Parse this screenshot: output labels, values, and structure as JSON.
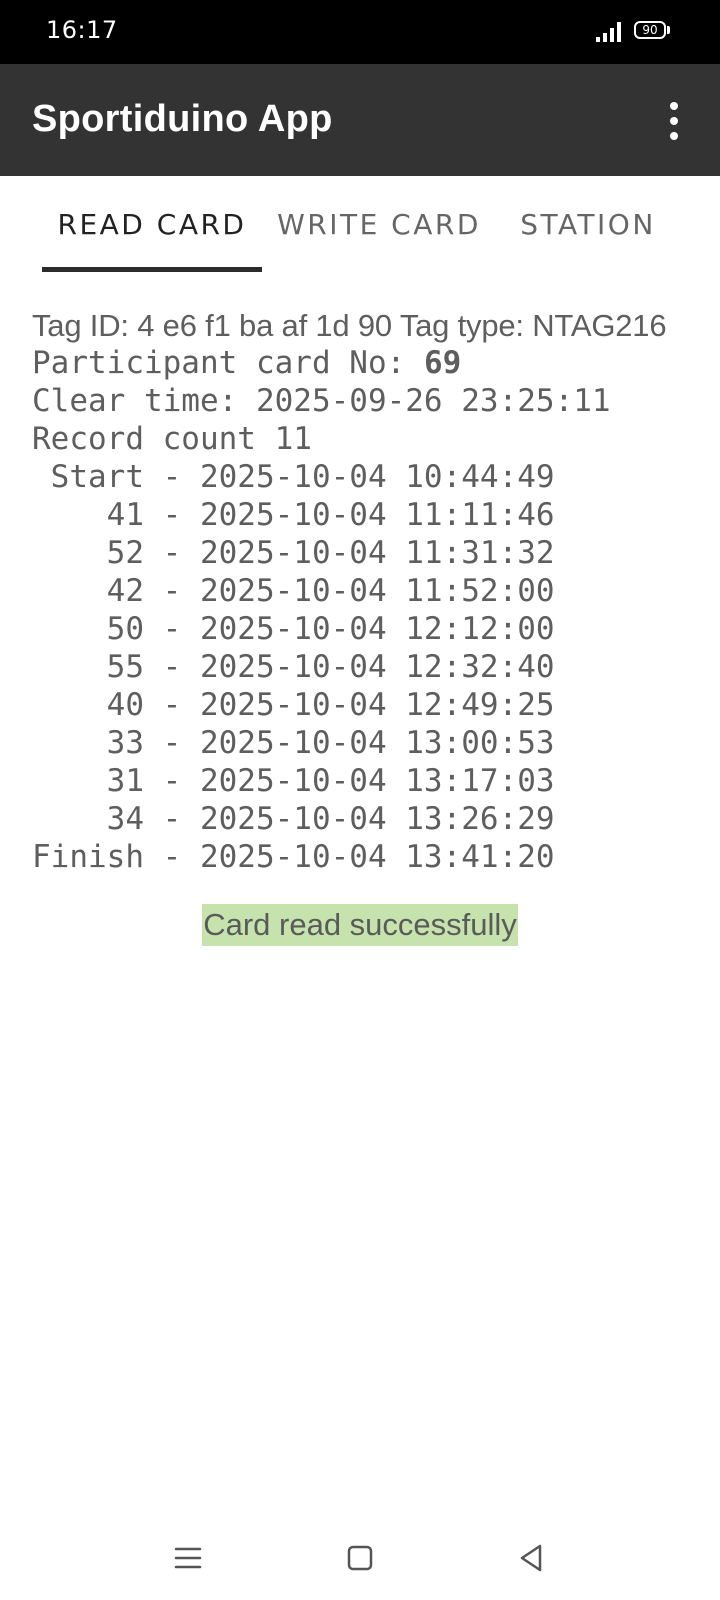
{
  "status_bar": {
    "time": "16:17",
    "battery": "90"
  },
  "app_bar": {
    "title": "Sportiduino App"
  },
  "tabs": [
    {
      "label": "READ CARD",
      "active": true
    },
    {
      "label": "WRITE CARD",
      "active": false
    },
    {
      "label": "STATION",
      "active": false
    }
  ],
  "card": {
    "tag_line": "Tag ID: 4 e6 f1 ba af 1d 90 Tag type: NTAG216",
    "participant_label": "Participant card No: ",
    "participant_number": "69",
    "clear_time_line": "Clear time: 2025-09-26 23:25:11",
    "record_count_line": "Record count 11",
    "records": [
      " Start - 2025-10-04 10:44:49",
      "    41 - 2025-10-04 11:11:46",
      "    52 - 2025-10-04 11:31:32",
      "    42 - 2025-10-04 11:52:00",
      "    50 - 2025-10-04 12:12:00",
      "    55 - 2025-10-04 12:32:40",
      "    40 - 2025-10-04 12:49:25",
      "    33 - 2025-10-04 13:00:53",
      "    31 - 2025-10-04 13:17:03",
      "    34 - 2025-10-04 13:26:29",
      "Finish - 2025-10-04 13:41:20"
    ]
  },
  "status_message": "Card read successfully",
  "colors": {
    "app_bar": "#333333",
    "status_highlight": "#c6e3ae"
  }
}
